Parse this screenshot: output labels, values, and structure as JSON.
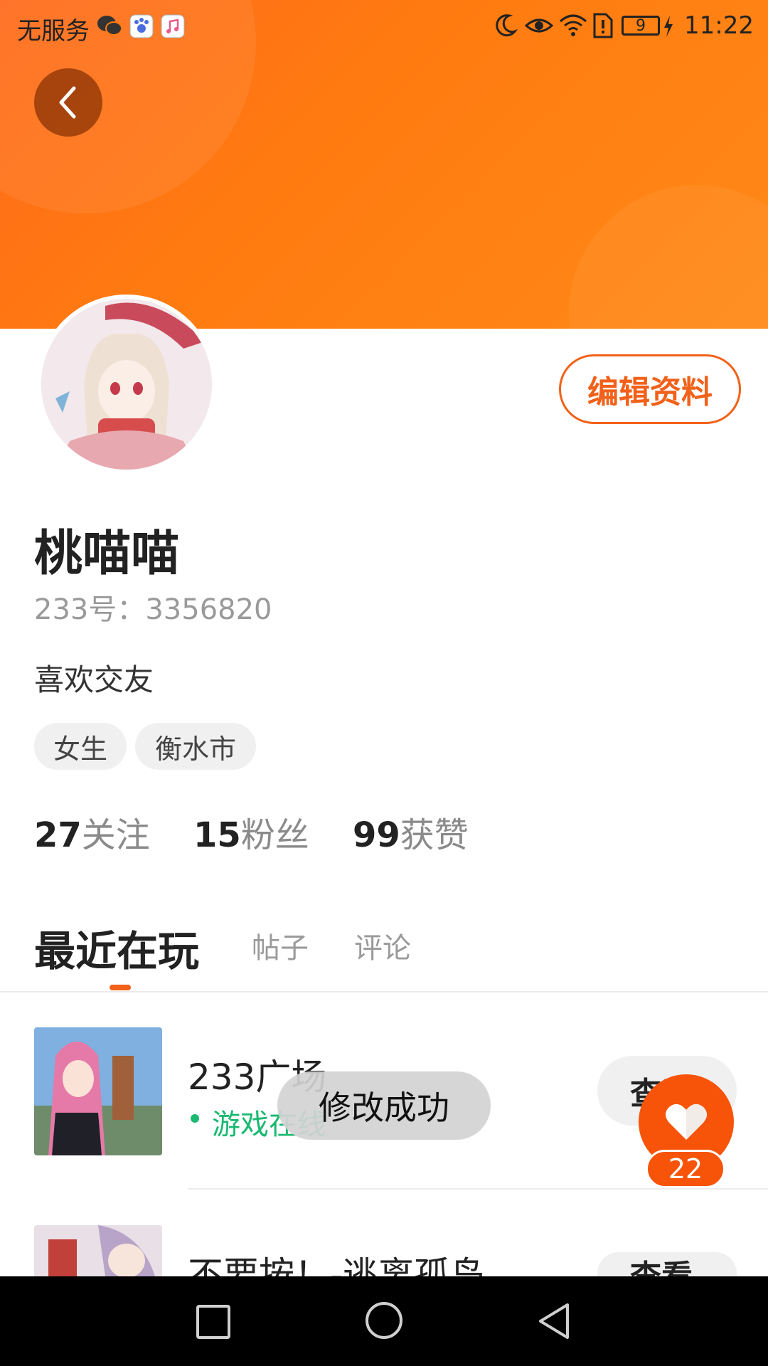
{
  "status_bar": {
    "carrier": "无服务",
    "battery": "9",
    "time": "11:22",
    "icons": [
      "wechat-icon",
      "baidu-icon",
      "music-icon",
      "moon-icon",
      "eye-icon",
      "wifi-icon",
      "sim-alert-icon",
      "battery-icon",
      "charging-icon"
    ]
  },
  "profile": {
    "nickname": "桃喵喵",
    "account": "233号：3356820",
    "bio": "喜欢交友",
    "tags": [
      "女生",
      "衡水市"
    ],
    "edit_label": "编辑资料"
  },
  "stats": [
    {
      "num": "27",
      "label": "关注"
    },
    {
      "num": "15",
      "label": "粉丝"
    },
    {
      "num": "99",
      "label": "获赞"
    }
  ],
  "tabs": [
    "最近在玩",
    "帖子",
    "评论"
  ],
  "games": [
    {
      "title": "233广场",
      "status": "游戏在线",
      "button": "查看"
    },
    {
      "title": "不要按！-逃离孤岛",
      "button": "查看"
    }
  ],
  "toast": "修改成功",
  "heart": {
    "count": "22"
  },
  "colors": {
    "accent": "#f2611a",
    "header": "#ff7a10",
    "online": "#1bb971"
  }
}
